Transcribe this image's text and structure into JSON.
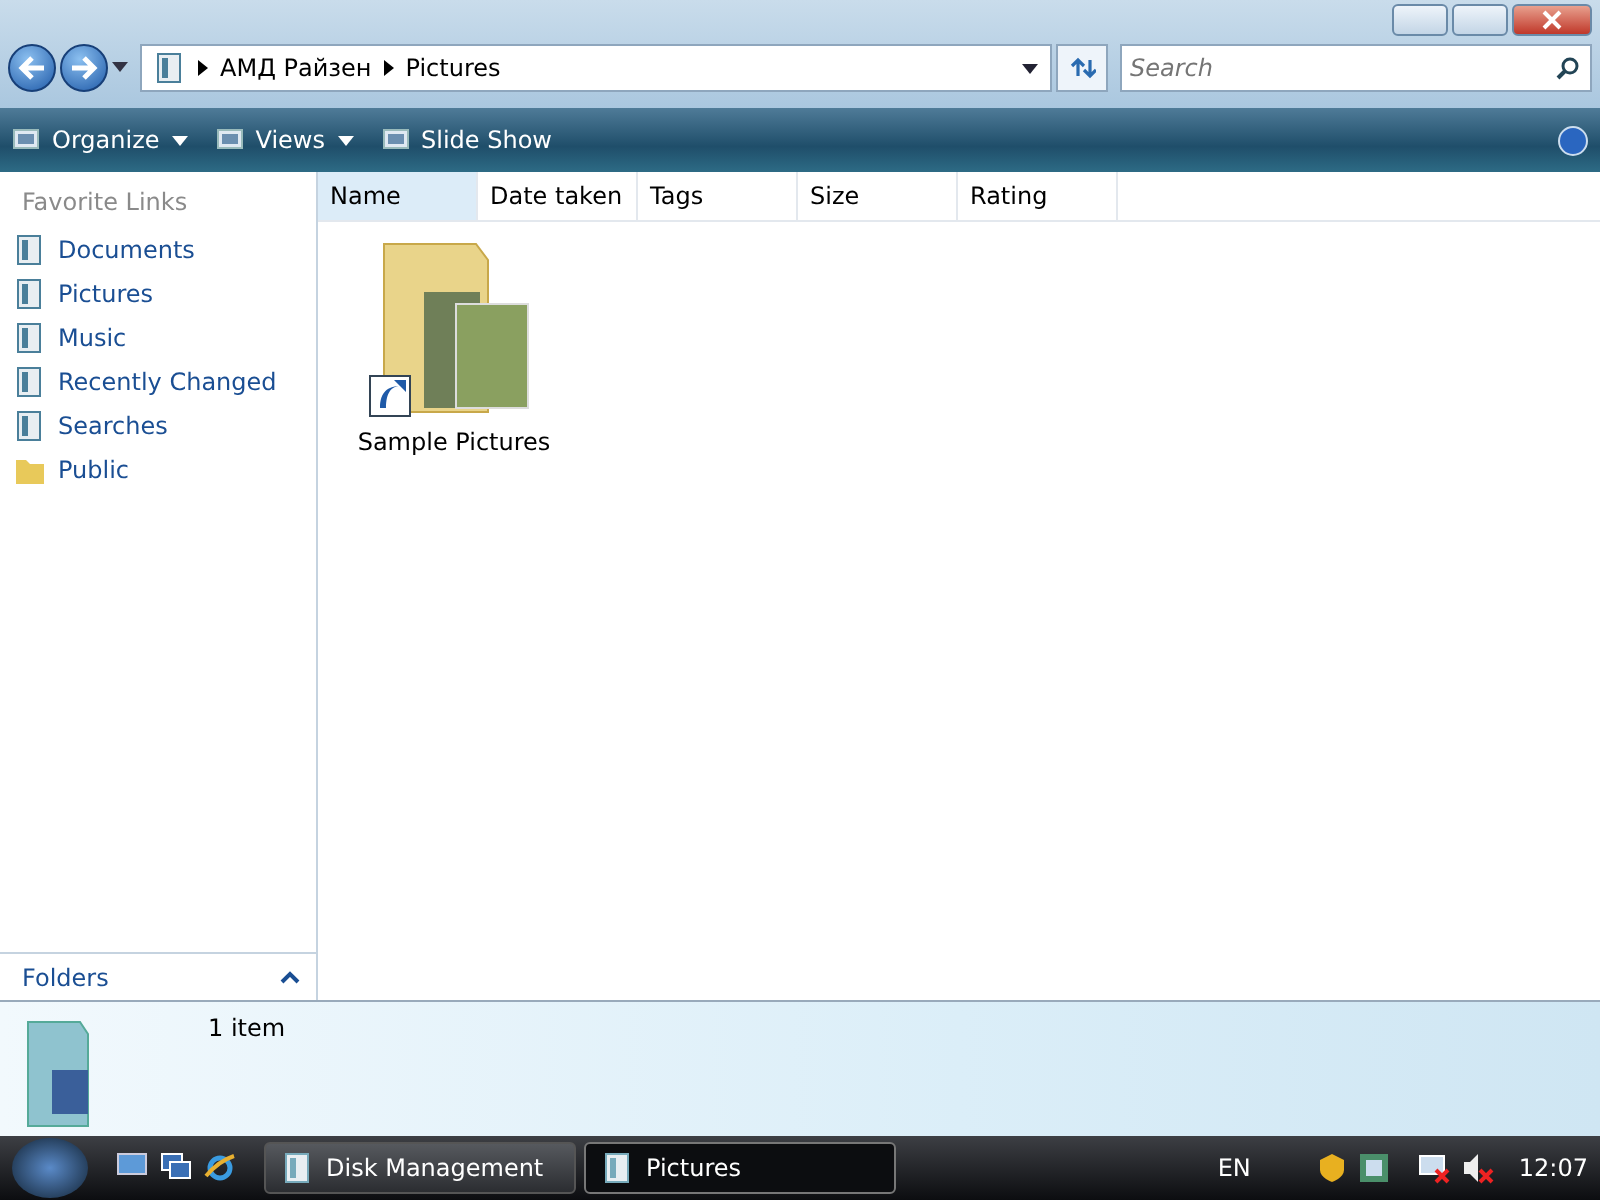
{
  "address": {
    "crumbs": [
      "АМД Райзен",
      "Pictures"
    ]
  },
  "search": {
    "placeholder": "Search"
  },
  "toolbar": {
    "buttons": [
      {
        "label": "Organize",
        "kind": "menu"
      },
      {
        "label": "Views",
        "kind": "menu"
      },
      {
        "label": "Slide Show",
        "kind": "plain"
      }
    ]
  },
  "favorites": {
    "title": "Favorite Links",
    "items": [
      "Documents",
      "Pictures",
      "Music",
      "Recently Changed",
      "Searches",
      "Public"
    ]
  },
  "folders": {
    "label": "Folders",
    "expanded": false
  },
  "columns": [
    {
      "label": "Name",
      "selected": true
    },
    {
      "label": "Date taken",
      "selected": false
    },
    {
      "label": "Tags",
      "selected": false
    },
    {
      "label": "Size",
      "selected": false
    },
    {
      "label": "Rating",
      "selected": false
    }
  ],
  "files": [
    {
      "name": "Sample Pictures",
      "selected": false
    }
  ],
  "details": {
    "count": "1 item"
  },
  "taskbar": {
    "tasks": [
      {
        "label": "Disk Management",
        "selected": false
      },
      {
        "label": "Pictures",
        "selected": true
      }
    ],
    "language": "EN",
    "clock": "12:07"
  }
}
